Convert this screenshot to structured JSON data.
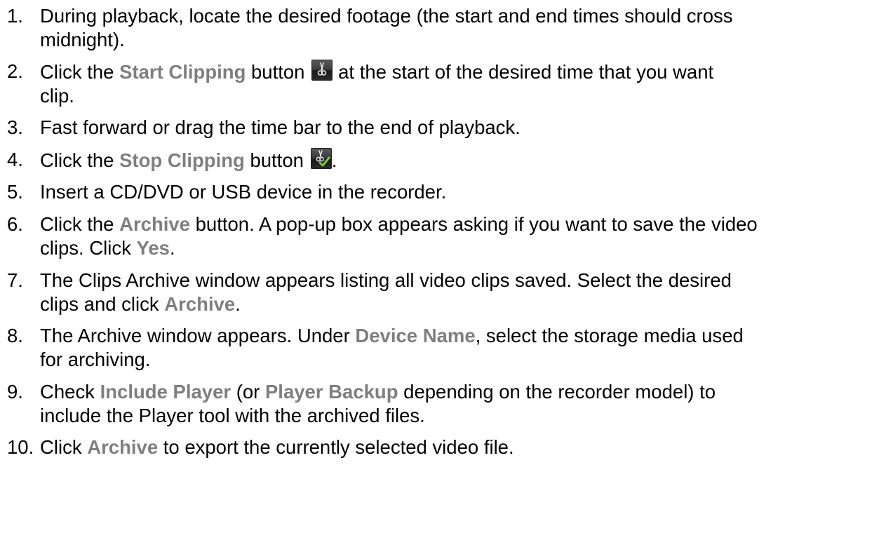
{
  "steps": [
    {
      "number": "1.",
      "lines": [
        "During playback, locate the desired footage (the start and end times should cross",
        "midnight)."
      ]
    },
    {
      "number": "2.",
      "pre": "Click the ",
      "ui": "Start Clipping",
      "mid": " button",
      "icon": "start-clipping-icon",
      "post": " at the start of the desired time that you want",
      "line2": "clip."
    },
    {
      "number": "3.",
      "text": "Fast forward or drag the time bar to the end of playback."
    },
    {
      "number": "4.",
      "pre": "Click the ",
      "ui": "Stop Clipping",
      "mid": " button",
      "icon": "stop-clipping-icon",
      "post": "."
    },
    {
      "number": "5.",
      "text": "Insert a CD/DVD or USB device in the recorder."
    },
    {
      "number": "6.",
      "pre": "Click the ",
      "ui": "Archive",
      "post": " button. A pop-up box appears asking if you want to save the video",
      "line2_pre": "clips. Click ",
      "line2_ui": "Yes",
      "line2_post": "."
    },
    {
      "number": "7.",
      "line1": "The Clips Archive window appears listing all video clips saved. Select the desired",
      "line2_pre": "clips and click ",
      "line2_ui": "Archive",
      "line2_post": "."
    },
    {
      "number": "8.",
      "pre": "The Archive window appears. Under ",
      "ui": "Device Name",
      "post": ", select the storage media used",
      "line2": "for archiving."
    },
    {
      "number": "9.",
      "pre": "Check ",
      "ui": "Include Player",
      "mid": " (or ",
      "ui2": "Player Backup",
      "post": " depending on the recorder model) to",
      "line2": "include the Player tool with the archived files."
    },
    {
      "number": "10.",
      "pre": "Click ",
      "ui": "Archive",
      "post": " to export the currently selected video file."
    }
  ],
  "colors": {
    "ui_label": "#7f7f7f",
    "text": "#000000",
    "background": "#ffffff",
    "check_green": "#7ac943"
  }
}
